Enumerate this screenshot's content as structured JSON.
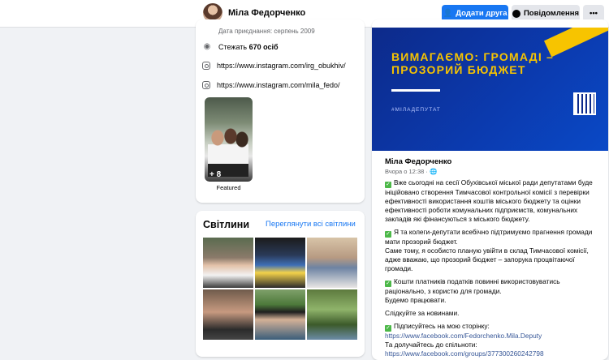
{
  "header": {
    "profile_name": "Міла Федорченко",
    "add_friend_label": "Додати друга",
    "message_label": "Повідомлення",
    "more_label": "•••"
  },
  "intro": {
    "joined": "Дата приєднання: серпень 2009",
    "followers_prefix": "Стежать ",
    "followers_count": "670 осіб",
    "instagram_1": "https://www.instagram.com/irg_obukhiv/",
    "instagram_2": "https://www.instagram.com/mila_fedo/",
    "featured_more": "+ 8",
    "featured_label": "Featured"
  },
  "photos": {
    "title": "Світлини",
    "see_all": "Переглянути всі світлини"
  },
  "post": {
    "banner_title": "ВИМАГАЄМО: ГРОМАДІ – ПРОЗОРИЙ БЮДЖЕТ",
    "banner_tag": "#МІЛАДЕПУТАТ",
    "author": "Міла Федорченко",
    "time": "Вчора о 12:38 · ",
    "p1": "Вже сьогодні на сесії Обухівської міської ради депутатами буде  ініційовано створення Тимчасової контрольної комісії з перевірки ефективності використання коштів міського бюджету та оцінки ефективності роботи комунальних підприємств, комунальних закладів які фінансуються з міського бюджету.",
    "p2": "Я та колеги-депутати всебічно підтримуємо прагнення громади мати прозорий бюджет.",
    "p2b": "Саме тому, я особисто планую увійти в склад Тимчасової комісії, адже вважаю, що прозорий бюджет – запорука процвітаючої громади.",
    "p3": "Кошти платників податків повинні використовуватись раціонально, з користю для громади.",
    "p3b": "Будемо працювати.",
    "p4": "Слідкуйте за новинами.",
    "p5": "Підписуйтесь на мою сторінку:",
    "link1": "https://www.facebook.com/Fedorchenko.Mila.Deputy",
    "p6": "Та долучайтесь до спільноти:",
    "link2": "https://www.facebook.com/groups/377300260242798"
  },
  "colors": {
    "brand": "#1877f2",
    "banner": "#0d2a8a",
    "banner_text": "#f7c400",
    "check": "#4cb848"
  }
}
